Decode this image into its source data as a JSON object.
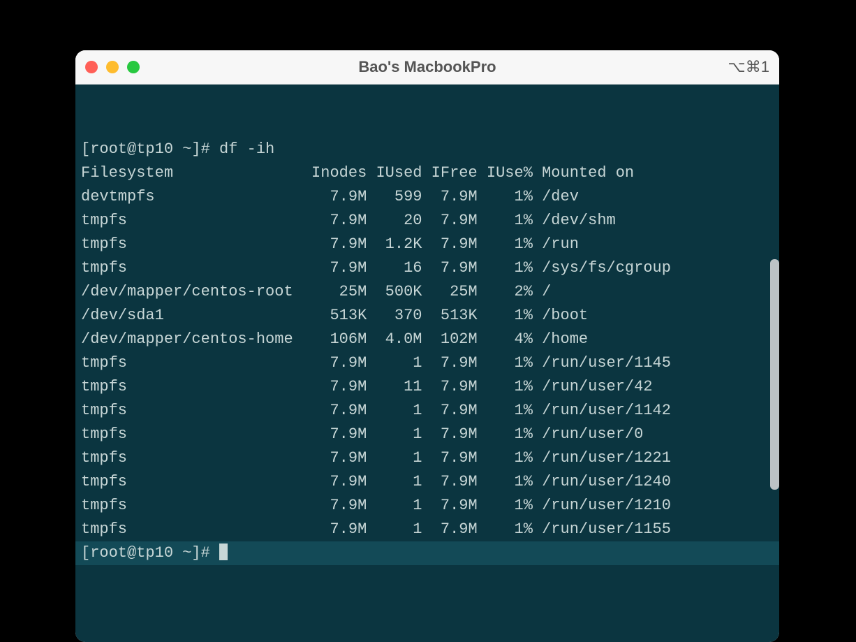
{
  "window": {
    "title": "Bao's MacbookPro",
    "shortcut": "⌥⌘1"
  },
  "prompt": {
    "line1": "[root@tp10 ~]# df -ih",
    "line2": "[root@tp10 ~]# "
  },
  "header": {
    "filesystem": "Filesystem",
    "inodes": "Inodes",
    "iused": "IUsed",
    "ifree": "IFree",
    "iusep": "IUse%",
    "mounted": "Mounted on"
  },
  "rows": [
    {
      "fs": "devtmpfs",
      "in": "7.9M",
      "iu": "599",
      "if": "7.9M",
      "ip": "1%",
      "mt": "/dev"
    },
    {
      "fs": "tmpfs",
      "in": "7.9M",
      "iu": "20",
      "if": "7.9M",
      "ip": "1%",
      "mt": "/dev/shm"
    },
    {
      "fs": "tmpfs",
      "in": "7.9M",
      "iu": "1.2K",
      "if": "7.9M",
      "ip": "1%",
      "mt": "/run"
    },
    {
      "fs": "tmpfs",
      "in": "7.9M",
      "iu": "16",
      "if": "7.9M",
      "ip": "1%",
      "mt": "/sys/fs/cgroup"
    },
    {
      "fs": "/dev/mapper/centos-root",
      "in": "25M",
      "iu": "500K",
      "if": "25M",
      "ip": "2%",
      "mt": "/"
    },
    {
      "fs": "/dev/sda1",
      "in": "513K",
      "iu": "370",
      "if": "513K",
      "ip": "1%",
      "mt": "/boot"
    },
    {
      "fs": "/dev/mapper/centos-home",
      "in": "106M",
      "iu": "4.0M",
      "if": "102M",
      "ip": "4%",
      "mt": "/home"
    },
    {
      "fs": "tmpfs",
      "in": "7.9M",
      "iu": "1",
      "if": "7.9M",
      "ip": "1%",
      "mt": "/run/user/1145"
    },
    {
      "fs": "tmpfs",
      "in": "7.9M",
      "iu": "11",
      "if": "7.9M",
      "ip": "1%",
      "mt": "/run/user/42"
    },
    {
      "fs": "tmpfs",
      "in": "7.9M",
      "iu": "1",
      "if": "7.9M",
      "ip": "1%",
      "mt": "/run/user/1142"
    },
    {
      "fs": "tmpfs",
      "in": "7.9M",
      "iu": "1",
      "if": "7.9M",
      "ip": "1%",
      "mt": "/run/user/0"
    },
    {
      "fs": "tmpfs",
      "in": "7.9M",
      "iu": "1",
      "if": "7.9M",
      "ip": "1%",
      "mt": "/run/user/1221"
    },
    {
      "fs": "tmpfs",
      "in": "7.9M",
      "iu": "1",
      "if": "7.9M",
      "ip": "1%",
      "mt": "/run/user/1240"
    },
    {
      "fs": "tmpfs",
      "in": "7.9M",
      "iu": "1",
      "if": "7.9M",
      "ip": "1%",
      "mt": "/run/user/1210"
    },
    {
      "fs": "tmpfs",
      "in": "7.9M",
      "iu": "1",
      "if": "7.9M",
      "ip": "1%",
      "mt": "/run/user/1155"
    }
  ],
  "cols": {
    "fs": 25,
    "in": 6,
    "iu": 6,
    "if": 6,
    "ip": 6,
    "mt": 0
  }
}
